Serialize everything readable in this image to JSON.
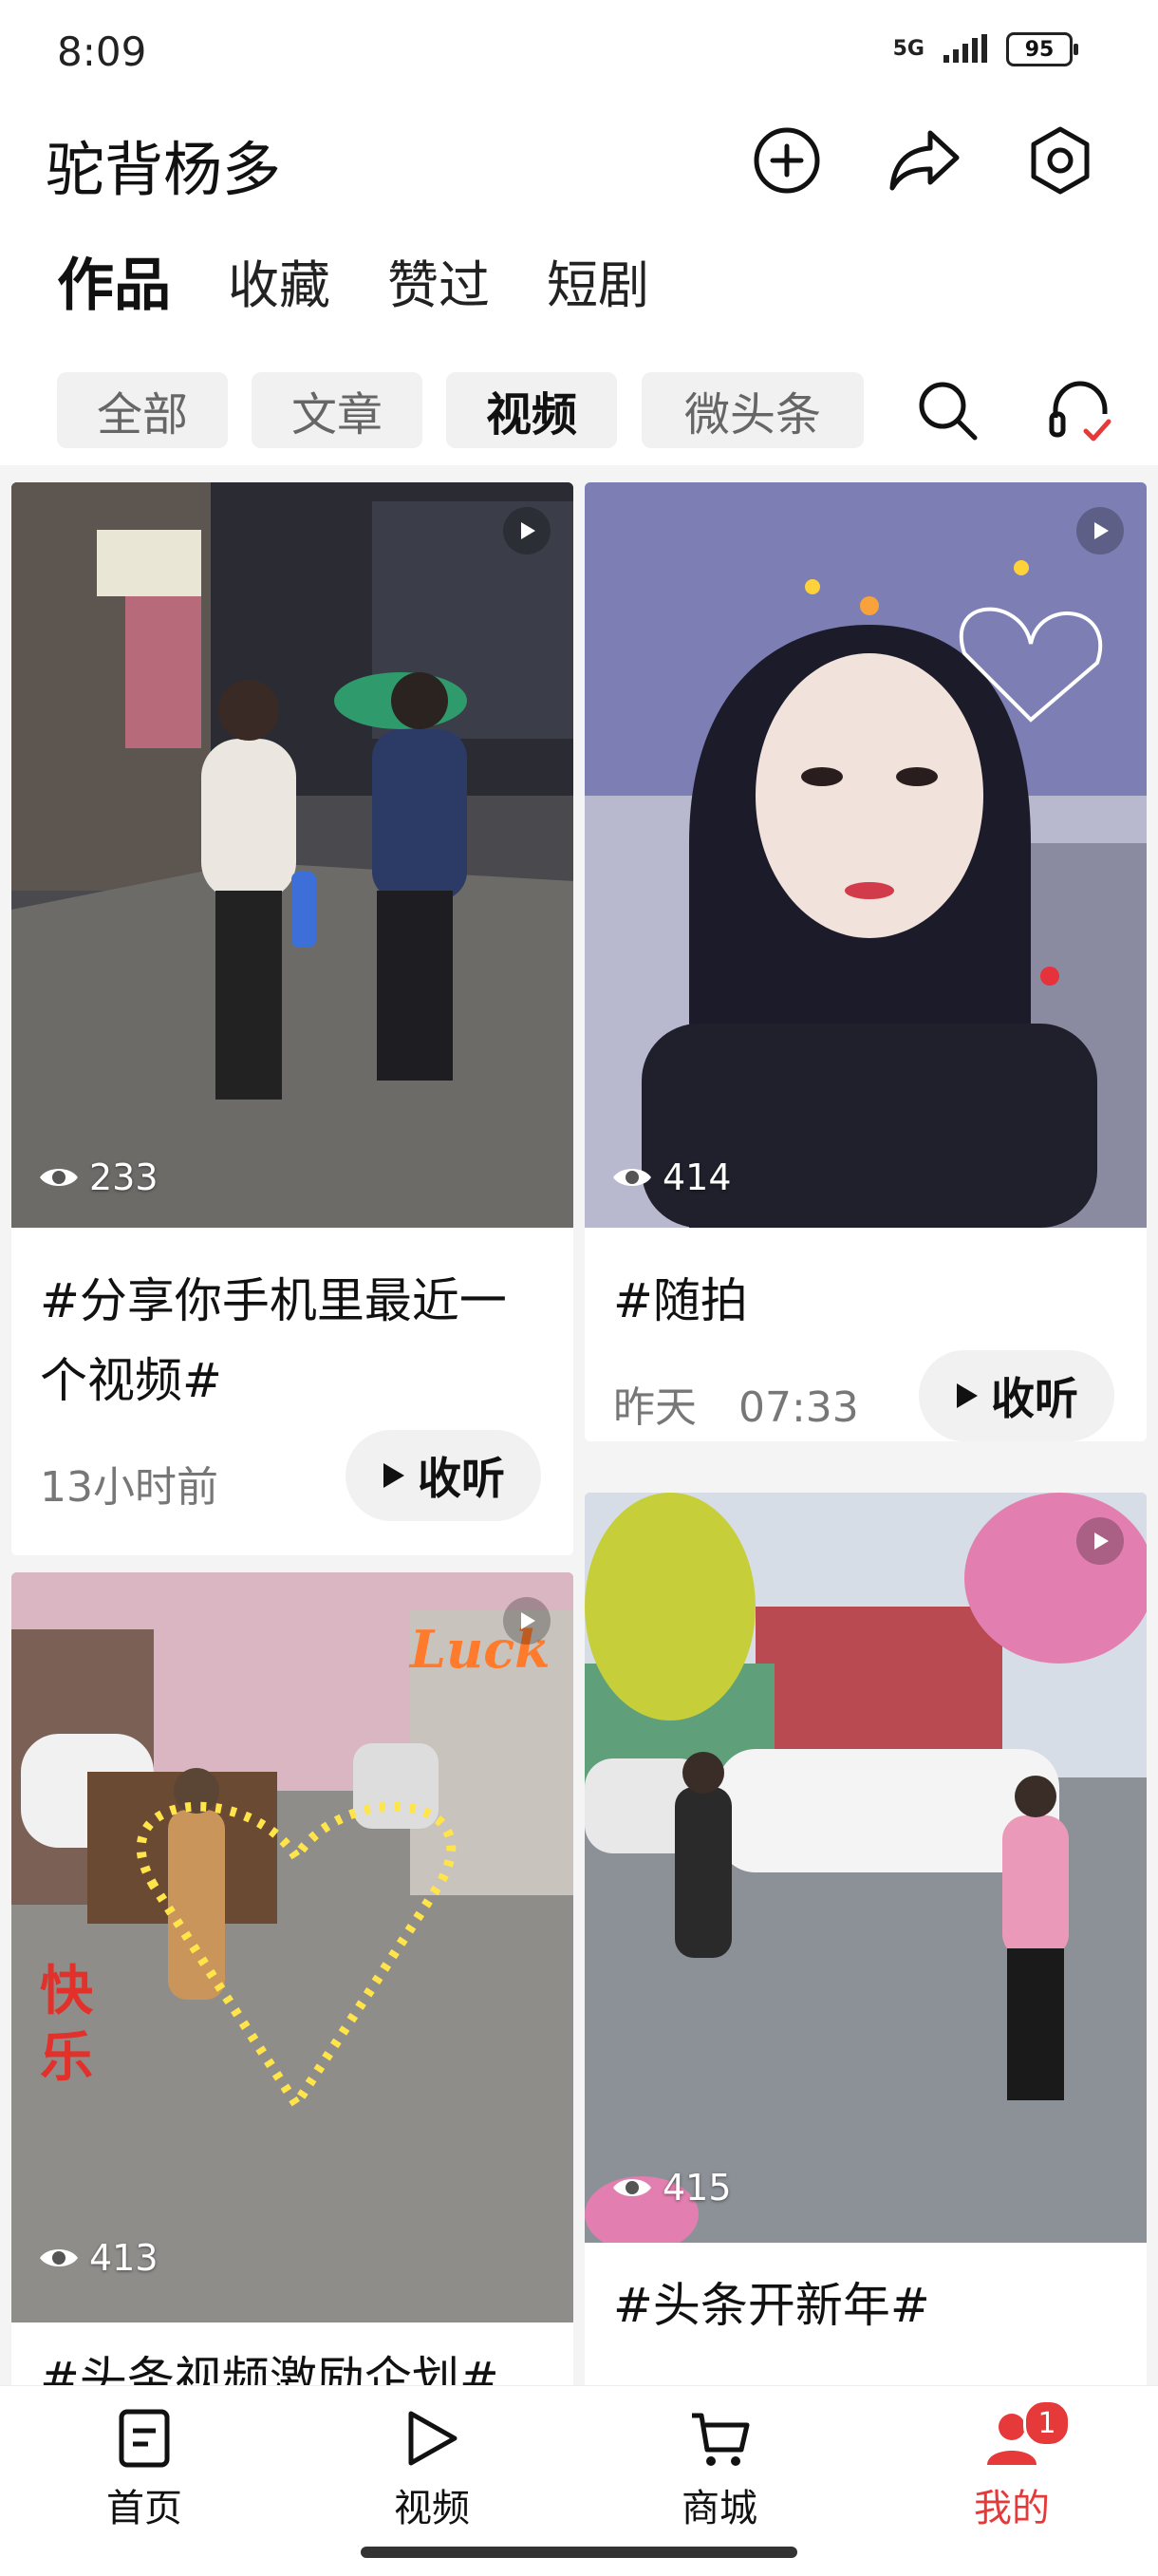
{
  "status_bar": {
    "time": "8:09",
    "network": "5G",
    "battery": "95"
  },
  "header": {
    "profile_name": "驼背杨多"
  },
  "tabs": [
    {
      "label": "作品",
      "active": true
    },
    {
      "label": "收藏",
      "active": false
    },
    {
      "label": "赞过",
      "active": false
    },
    {
      "label": "短剧",
      "active": false
    }
  ],
  "filters": [
    {
      "label": "全部",
      "active": false
    },
    {
      "label": "文章",
      "active": false
    },
    {
      "label": "视频",
      "active": true
    },
    {
      "label": "微头条",
      "active": false
    }
  ],
  "cards": [
    {
      "views": "233",
      "title_line1": "#分享你手机里最近一",
      "title_line2": "个视频#",
      "time": "13小时前",
      "listen": "收听"
    },
    {
      "views": "414",
      "title_line1": "#随拍",
      "time": "昨天　07:33",
      "listen": "收听"
    },
    {
      "views": "413",
      "title_line1": "#头条视频激励企划#"
    },
    {
      "views": "415",
      "title_line1": "#头条开新年#"
    }
  ],
  "bottom_nav": [
    {
      "label": "首页",
      "icon": "home-doc-icon"
    },
    {
      "label": "视频",
      "icon": "video-play-icon"
    },
    {
      "label": "商城",
      "icon": "cart-icon"
    },
    {
      "label": "我的",
      "icon": "profile-icon",
      "badge": "1",
      "active": true
    }
  ],
  "colors": {
    "accent": "#e63a3a",
    "background": "#f4f4f4",
    "chip": "#f1f1f1"
  }
}
